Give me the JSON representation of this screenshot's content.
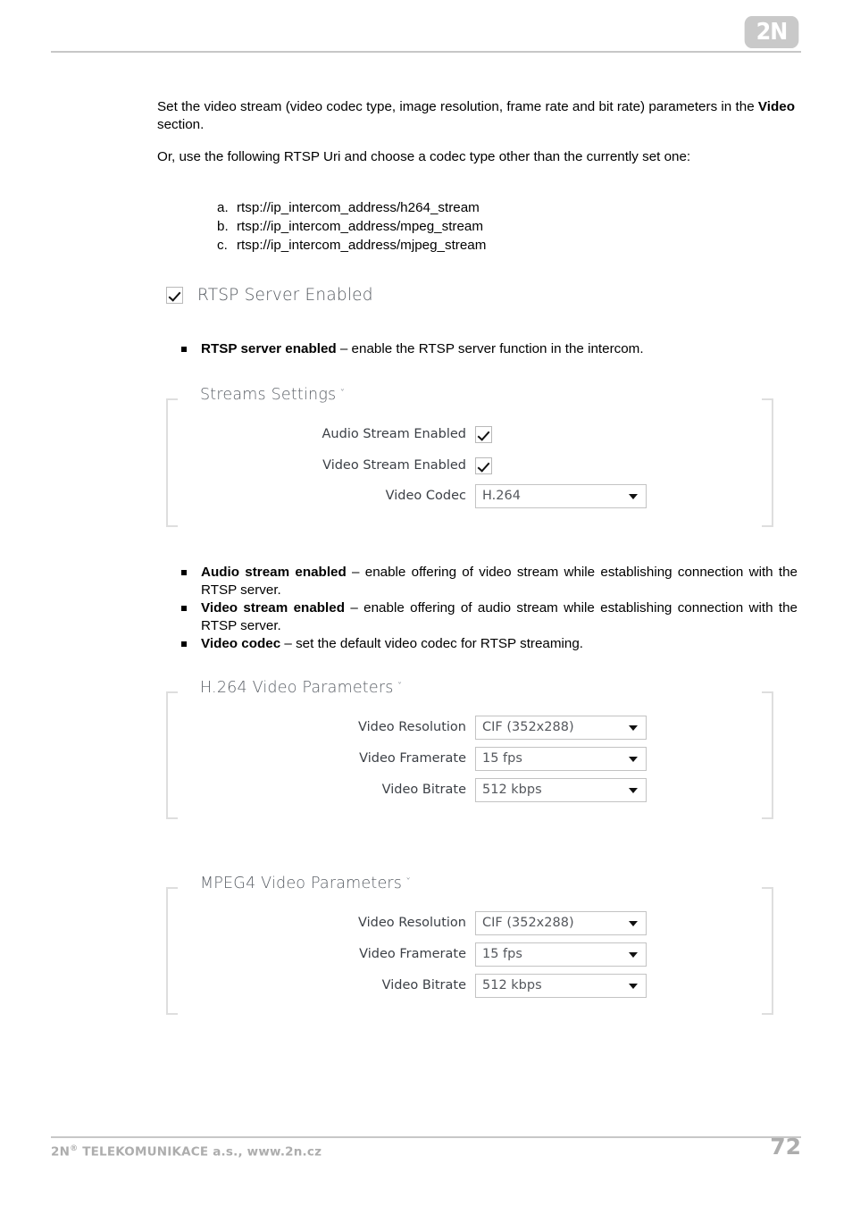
{
  "header": {
    "logo_text": "2N"
  },
  "body": {
    "para1_part1": "Set the video stream (video codec type, image resolution, frame rate and bit rate) parameters in the ",
    "para1_bold": "Video",
    "para1_part2": " section.",
    "para2": "Or, use the following RTSP Uri and choose a codec type other than the currently set one:",
    "uri_list": [
      {
        "marker": "a.",
        "text": "rtsp://ip_intercom_address/h264_stream"
      },
      {
        "marker": "b.",
        "text": "rtsp://ip_intercom_address/mpeg_stream"
      },
      {
        "marker": "c.",
        "text": "rtsp://ip_intercom_address/mjpeg_stream"
      }
    ]
  },
  "rtsp_toggle": {
    "label": "RTSP Server Enabled",
    "checked": true
  },
  "bullets_1": [
    {
      "bold": "RTSP server enabled",
      "rest": " – enable the RTSP server function in the intercom."
    }
  ],
  "bullets_2": [
    {
      "bold": "Audio stream enabled",
      "rest": " – enable offering of video stream while establishing connection with the RTSP server."
    },
    {
      "bold": "Video stream enabled",
      "rest": " –  enable offering of audio stream while establishing connection with the RTSP server."
    },
    {
      "bold": "Video codec",
      "rest": " – set the default video codec for RTSP streaming."
    }
  ],
  "panels": {
    "streams": {
      "title": "Streams Settings",
      "chevron": "ˇ",
      "rows": [
        {
          "label": "Audio Stream Enabled",
          "type": "checkbox",
          "checked": true
        },
        {
          "label": "Video Stream Enabled",
          "type": "checkbox",
          "checked": true
        },
        {
          "label": "Video Codec",
          "type": "select",
          "value": "H.264"
        }
      ]
    },
    "h264": {
      "title": "H.264 Video Parameters",
      "chevron": "ˇ",
      "rows": [
        {
          "label": "Video Resolution",
          "type": "select",
          "value": "CIF (352x288)"
        },
        {
          "label": "Video Framerate",
          "type": "select",
          "value": "15 fps"
        },
        {
          "label": "Video Bitrate",
          "type": "select",
          "value": "512 kbps"
        }
      ]
    },
    "mpeg4": {
      "title": "MPEG4 Video Parameters",
      "chevron": "ˇ",
      "rows": [
        {
          "label": "Video Resolution",
          "type": "select",
          "value": "CIF (352x288)"
        },
        {
          "label": "Video Framerate",
          "type": "select",
          "value": "15 fps"
        },
        {
          "label": "Video Bitrate",
          "type": "select",
          "value": "512 kbps"
        }
      ]
    }
  },
  "footer": {
    "company_pre": "2N",
    "company_sup": "®",
    "company_rest": " TELEKOMUNIKACE a.s., www.2n.cz",
    "page_number": "72"
  }
}
